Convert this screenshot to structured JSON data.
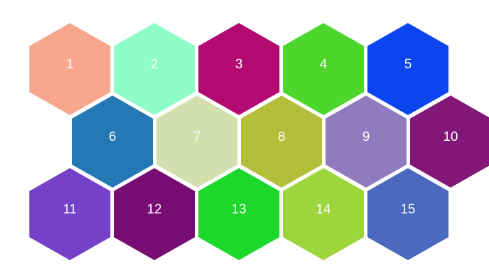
{
  "hexagons": [
    {
      "label": "1",
      "color": "#F7A78E"
    },
    {
      "label": "2",
      "color": "#8EFDC7"
    },
    {
      "label": "3",
      "color": "#B30A71"
    },
    {
      "label": "4",
      "color": "#4DD62B"
    },
    {
      "label": "5",
      "color": "#0A45F0"
    },
    {
      "label": "6",
      "color": "#2479B5"
    },
    {
      "label": "7",
      "color": "#D4DFB0"
    },
    {
      "label": "8",
      "color": "#B3BE3A"
    },
    {
      "label": "9",
      "color": "#8F7BBE"
    },
    {
      "label": "10",
      "color": "#831778"
    },
    {
      "label": "11",
      "color": "#7541C8"
    },
    {
      "label": "12",
      "color": "#770C73"
    },
    {
      "label": "13",
      "color": "#1CD82B"
    },
    {
      "label": "14",
      "color": "#9CD63C"
    },
    {
      "label": "15",
      "color": "#4B69BE"
    }
  ]
}
